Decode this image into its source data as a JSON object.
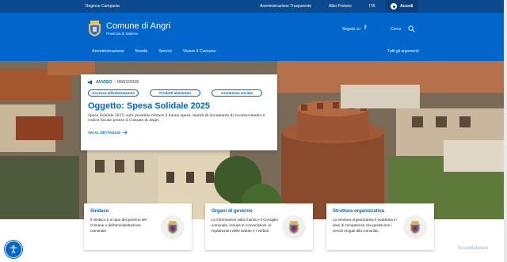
{
  "topbar": {
    "region": "Regione Campania",
    "links": [
      "Amministrazione Trasparente",
      "Albo Pretorio"
    ],
    "lang": "ITA",
    "login": "Accedi"
  },
  "header": {
    "title": "Comune di Angri",
    "subtitle": "Provincia di Salerno",
    "follow": "Seguici su",
    "search": "Cerca"
  },
  "nav": {
    "items": [
      "Amministrazione",
      "Novità",
      "Servizi",
      "Vivere il Comune"
    ],
    "all": "Tutti gli argomenti"
  },
  "alert": {
    "tag": "AVVISO",
    "date": "- 09/01/2026",
    "chips": [
      "Accesso all'informazione",
      "Prodotti alimentari",
      "Assistenza sociale"
    ],
    "title": "Oggetto: Spesa Solidale 2025",
    "text": "Spesa Solidale 2025: sarà possibile ritirare il buono spesa, muniti di documento di riconoscimento e codice fiscale presso il Comune di Angri.",
    "link": "VAI AL DETTAGLIO"
  },
  "boxes": [
    {
      "title": "Sindaco",
      "text": "Il sindaco è a capo del governo del Comune e dell'amministrazione comunale."
    },
    {
      "title": "Organi di governo",
      "text": "Le informazioni sulla Giunta e il Consiglio comunale, incluse le convocazioni, le registrazioni delle sedute e i verbali."
    },
    {
      "title": "Struttura organizzativa",
      "text": "La struttura organizzativa è suddivisa in aree di competenze che gestiscono i servizi erogati alla comunità."
    }
  ],
  "watermark": "ScanMalware",
  "colors": {
    "primary": "#0066cc",
    "topbar": "#0b4a8e"
  }
}
